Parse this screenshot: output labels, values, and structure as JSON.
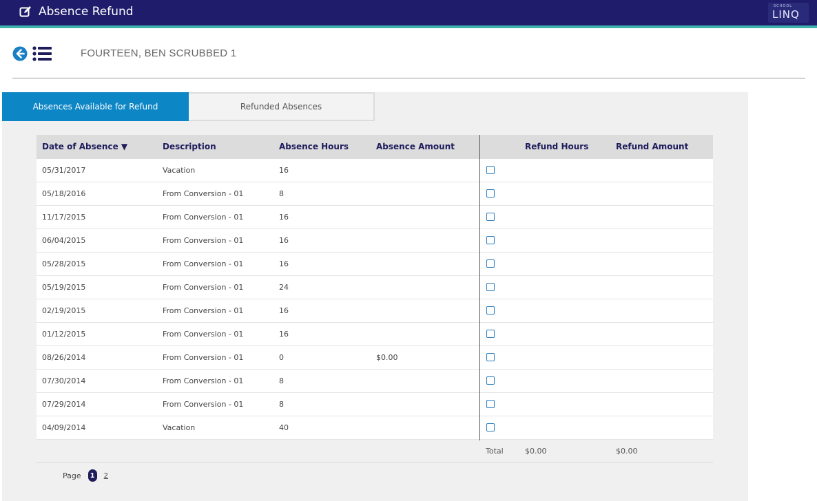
{
  "header": {
    "title": "Absence Refund",
    "logo_small": "SCHOOL",
    "logo_main": "LINQ",
    "colors": {
      "bar": "#1f1c6b",
      "accent_line": "#3fb0ac"
    }
  },
  "employee": {
    "name": "FOURTEEN, BEN SCRUBBED 1"
  },
  "tabs": [
    {
      "label": "Absences Available for Refund",
      "active": true
    },
    {
      "label": "Refunded Absences",
      "active": false
    }
  ],
  "table": {
    "columns": {
      "date": "Date of Absence ▼",
      "description": "Description",
      "absence_hours": "Absence Hours",
      "absence_amount": "Absence Amount",
      "refund_hours": "Refund Hours",
      "refund_amount": "Refund Amount"
    },
    "rows": [
      {
        "date": "05/31/2017",
        "description": "Vacation",
        "hours": "16",
        "amount": ""
      },
      {
        "date": "05/18/2016",
        "description": "From Conversion - 01",
        "hours": "8",
        "amount": ""
      },
      {
        "date": "11/17/2015",
        "description": "From Conversion - 01",
        "hours": "16",
        "amount": ""
      },
      {
        "date": "06/04/2015",
        "description": "From Conversion - 01",
        "hours": "16",
        "amount": ""
      },
      {
        "date": "05/28/2015",
        "description": "From Conversion - 01",
        "hours": "16",
        "amount": ""
      },
      {
        "date": "05/19/2015",
        "description": "From Conversion - 01",
        "hours": "24",
        "amount": ""
      },
      {
        "date": "02/19/2015",
        "description": "From Conversion - 01",
        "hours": "16",
        "amount": ""
      },
      {
        "date": "01/12/2015",
        "description": "From Conversion - 01",
        "hours": "16",
        "amount": ""
      },
      {
        "date": "08/26/2014",
        "description": "From Conversion - 01",
        "hours": "0",
        "amount": "$0.00"
      },
      {
        "date": "07/30/2014",
        "description": "From Conversion - 01",
        "hours": "8",
        "amount": ""
      },
      {
        "date": "07/29/2014",
        "description": "From Conversion - 01",
        "hours": "8",
        "amount": ""
      },
      {
        "date": "04/09/2014",
        "description": "Vacation",
        "hours": "40",
        "amount": ""
      }
    ],
    "total": {
      "label": "Total",
      "refund_hours": "$0.00",
      "refund_amount": "$0.00"
    }
  },
  "pager": {
    "label": "Page",
    "current": "1",
    "other": "2"
  },
  "icons": {
    "edit": "edit-icon",
    "back": "back-arrow-icon",
    "list": "list-icon"
  }
}
